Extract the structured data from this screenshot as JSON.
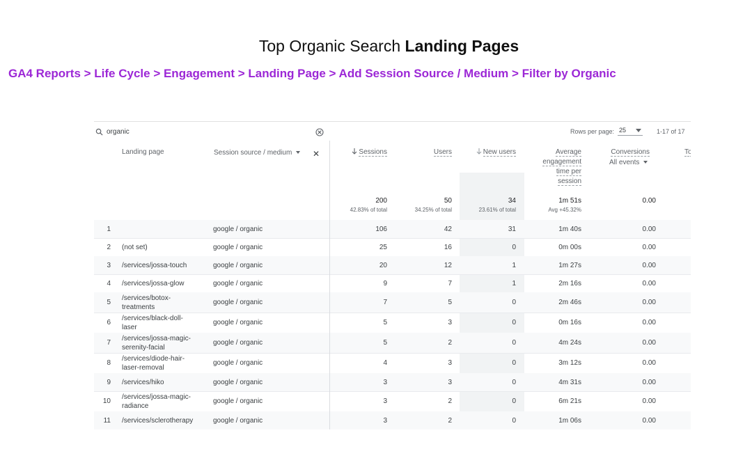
{
  "title": {
    "normal": "Top Organic Search ",
    "bold": "Landing Pages"
  },
  "breadcrumb": "GA4 Reports > Life Cycle > Engagement > Landing Page > Add Session Source / Medium > Filter by Organic",
  "toolbar": {
    "search_value": "organic",
    "rows_per_page_label": "Rows per page:",
    "rows_per_page_value": "25",
    "range": "1-17 of 17"
  },
  "columns": {
    "landing_page": "Landing page",
    "source_medium": "Session source / medium",
    "sessions": "Sessions",
    "users": "Users",
    "new_users": "New users",
    "avg_eng": [
      "Average",
      "engagement",
      "time per",
      "session"
    ],
    "conversions": "Conversions",
    "conversions_sub": "All events",
    "total_partial": "To"
  },
  "totals": {
    "sessions": "200",
    "sessions_sub": "42.83% of total",
    "users": "50",
    "users_sub": "34.25% of total",
    "new_users": "34",
    "new_users_sub": "23.61% of total",
    "avg_eng": "1m 51s",
    "avg_eng_sub": "Avg +45.32%",
    "conversions": "0.00"
  },
  "rows": [
    {
      "idx": "1",
      "lp1": "",
      "lp2": "",
      "src": "google / organic",
      "sessions": "106",
      "users": "42",
      "new_users": "31",
      "avg": "1m 40s",
      "conv": "0.00"
    },
    {
      "idx": "2",
      "lp1": "(not set)",
      "lp2": "",
      "src": "google / organic",
      "sessions": "25",
      "users": "16",
      "new_users": "0",
      "avg": "0m 00s",
      "conv": "0.00"
    },
    {
      "idx": "3",
      "lp1": "/services/jossa-touch",
      "lp2": "",
      "src": "google / organic",
      "sessions": "20",
      "users": "12",
      "new_users": "1",
      "avg": "1m 27s",
      "conv": "0.00"
    },
    {
      "idx": "4",
      "lp1": "/services/jossa-glow",
      "lp2": "",
      "src": "google / organic",
      "sessions": "9",
      "users": "7",
      "new_users": "1",
      "avg": "2m 16s",
      "conv": "0.00"
    },
    {
      "idx": "5",
      "lp1": "/services/botox-",
      "lp2": "treatments",
      "src": "google / organic",
      "sessions": "7",
      "users": "5",
      "new_users": "0",
      "avg": "2m 46s",
      "conv": "0.00"
    },
    {
      "idx": "6",
      "lp1": "/services/black-doll-",
      "lp2": "laser",
      "src": "google / organic",
      "sessions": "5",
      "users": "3",
      "new_users": "0",
      "avg": "0m 16s",
      "conv": "0.00"
    },
    {
      "idx": "7",
      "lp1": "/services/jossa-magic-",
      "lp2": "serenity-facial",
      "src": "google / organic",
      "sessions": "5",
      "users": "2",
      "new_users": "0",
      "avg": "4m 24s",
      "conv": "0.00"
    },
    {
      "idx": "8",
      "lp1": "/services/diode-hair-",
      "lp2": "laser-removal",
      "src": "google / organic",
      "sessions": "4",
      "users": "3",
      "new_users": "0",
      "avg": "3m 12s",
      "conv": "0.00"
    },
    {
      "idx": "9",
      "lp1": "/services/hiko",
      "lp2": "",
      "src": "google / organic",
      "sessions": "3",
      "users": "3",
      "new_users": "0",
      "avg": "4m 31s",
      "conv": "0.00"
    },
    {
      "idx": "10",
      "lp1": "/services/jossa-magic-",
      "lp2": "radiance",
      "src": "google / organic",
      "sessions": "3",
      "users": "2",
      "new_users": "0",
      "avg": "6m 21s",
      "conv": "0.00"
    },
    {
      "idx": "11",
      "lp1": "/services/sclerotherapy",
      "lp2": "",
      "src": "google / organic",
      "sessions": "3",
      "users": "2",
      "new_users": "0",
      "avg": "1m 06s",
      "conv": "0.00"
    }
  ],
  "colors": {
    "accent": "#9c27d6",
    "grid": "#dadce0",
    "highlight": "#f1f3f4"
  }
}
